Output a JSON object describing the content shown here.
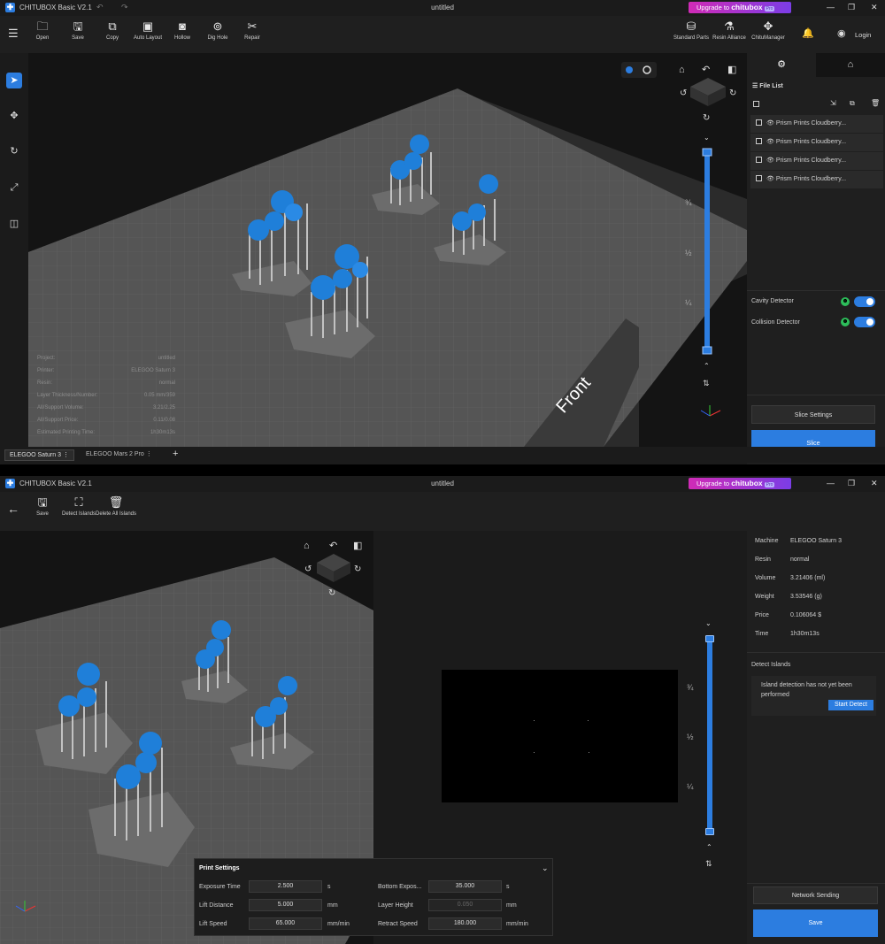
{
  "top": {
    "app_title": "CHITUBOX Basic V2.1",
    "doc_title": "untitled",
    "upgrade_prefix": "Upgrade to",
    "upgrade_brand": "chitubox",
    "upgrade_badge": "Pro",
    "toolbar": [
      {
        "label": "Open",
        "icon": "folder-icon"
      },
      {
        "label": "Save",
        "icon": "save-icon"
      },
      {
        "label": "Copy",
        "icon": "copy-icon"
      },
      {
        "label": "Auto Layout",
        "icon": "auto-layout-icon"
      },
      {
        "label": "Hollow",
        "icon": "hollow-icon"
      },
      {
        "label": "Dig Hole",
        "icon": "dig-hole-icon"
      },
      {
        "label": "Repair",
        "icon": "repair-icon"
      }
    ],
    "right_tools": [
      {
        "label": "Standard Parts"
      },
      {
        "label": "Resin Alliance"
      },
      {
        "label": "ChituManager"
      }
    ],
    "login": "Login",
    "file_list_title": "File List",
    "files": [
      "Prism Prints Cloudberry...",
      "Prism Prints Cloudberry...",
      "Prism Prints Cloudberry...",
      "Prism Prints Cloudberry..."
    ],
    "cavity_detector": "Cavity Detector",
    "collision_detector": "Collision Detector",
    "slice_settings": "Slice Settings",
    "slice": "Slice",
    "front_label": "Front",
    "slider_marks": [
      "¾",
      "½",
      "¼"
    ],
    "project_info": [
      {
        "k": "Project:",
        "v": "untitled"
      },
      {
        "k": "Printer:",
        "v": "ELEGOO Saturn 3"
      },
      {
        "k": "Resin:",
        "v": "normal"
      },
      {
        "k": "Layer Thickness/Number:",
        "v": "0.05 mm/359"
      },
      {
        "k": "All/Support Volume:",
        "v": "3.21/2.25"
      },
      {
        "k": "All/Support Price:",
        "v": "0.11/0.08"
      },
      {
        "k": "Estimated Printing Time:",
        "v": "1h30m13s"
      }
    ],
    "printer_tabs": [
      "ELEGOO Saturn 3",
      "ELEGOO Mars 2 Pro"
    ],
    "add_tab": "+"
  },
  "bottom": {
    "app_title": "CHITUBOX Basic V2.1",
    "doc_title": "untitled",
    "toolbar": [
      {
        "label": "Save"
      },
      {
        "label": "Detect Islands"
      },
      {
        "label": "Delete All Islands"
      }
    ],
    "specs": [
      {
        "k": "Machine",
        "v": "ELEGOO Saturn 3"
      },
      {
        "k": "Resin",
        "v": "normal"
      },
      {
        "k": "Volume",
        "v": "3.21406 (ml)"
      },
      {
        "k": "Weight",
        "v": "3.53546 (g)"
      },
      {
        "k": "Price",
        "v": "0.106064 $"
      },
      {
        "k": "Time",
        "v": "1h30m13s"
      }
    ],
    "detect_islands_title": "Detect Islands",
    "island_msg": "Island detection has not yet been performed",
    "start_detect": "Start Detect",
    "network_sending": "Network Sending",
    "save": "Save",
    "print_settings": {
      "title": "Print Settings",
      "rows": [
        {
          "label": "Exposure Time",
          "value": "2.500",
          "unit": "s",
          "label2": "Bottom Expos...",
          "value2": "35.000",
          "unit2": "s"
        },
        {
          "label": "Lift Distance",
          "value": "5.000",
          "unit": "mm",
          "label2": "Layer Height",
          "value2": "0.050",
          "unit2": "mm"
        },
        {
          "label": "Lift Speed",
          "value": "65.000",
          "unit": "mm/min",
          "label2": "Retract Speed",
          "value2": "180.000",
          "unit2": "mm/min"
        }
      ]
    },
    "slider_marks": [
      "¾",
      "½",
      "¼"
    ]
  },
  "colors": {
    "accent": "#2c7de0",
    "model_blue": "#1f7fd9",
    "support_gray": "#b8b8b8",
    "plate": "#545454",
    "toggle_on": "#2c7de0",
    "indicator": "#2dbd5a"
  }
}
